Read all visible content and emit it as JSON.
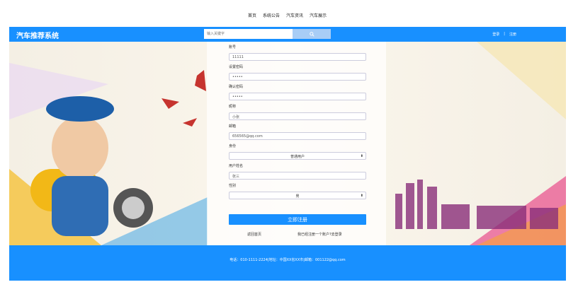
{
  "nav": {
    "items": [
      "首页",
      "系统公告",
      "汽车资讯",
      "汽车展示"
    ]
  },
  "header": {
    "brand": "汽车推荐系统",
    "search_placeholder": "输入关键字",
    "login": "登录",
    "separator": "|",
    "register": "注册"
  },
  "form": {
    "account_label": "账号",
    "account_value": "11111",
    "password_label": "设置密码",
    "password_value": "•••••",
    "confirm_label": "确认密码",
    "confirm_value": "•••••",
    "nickname_label": "昵称",
    "nickname_value": "小张",
    "email_label": "邮箱",
    "email_value": "656565@qq.com",
    "identity_label": "身份",
    "identity_value": "普通用户",
    "realname_label": "用户姓名",
    "realname_value": "张三",
    "gender_label": "性别",
    "gender_value": "男",
    "submit_label": "立即注册",
    "back_home": "返回首页",
    "login_link": "我已经注册一个账户?去登录"
  },
  "footer": {
    "text": "电话：010-1111-2224|地址：中国XX省XX市|邮箱：001122@qq.com"
  },
  "colors": {
    "primary": "#1890ff"
  }
}
